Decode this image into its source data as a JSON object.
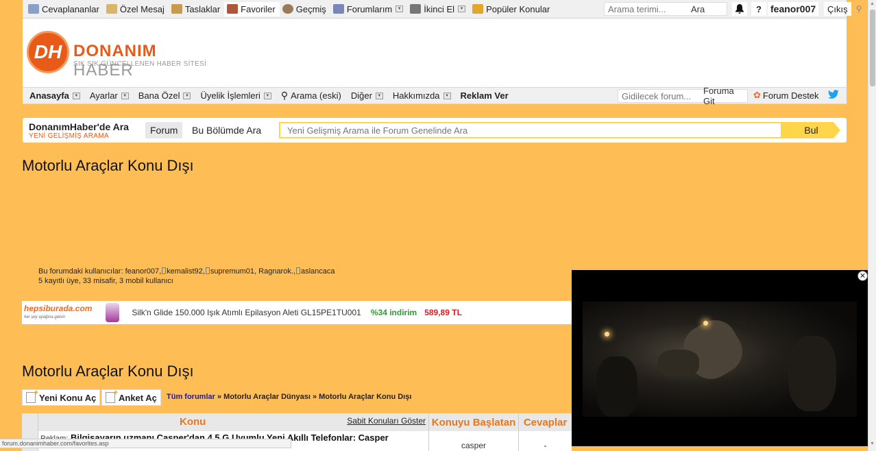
{
  "topbar": {
    "items": [
      {
        "label": "Cevaplananlar",
        "icon": "replies-icon",
        "color": "#8aa0c8"
      },
      {
        "label": "Özel Mesaj",
        "icon": "envelope-icon",
        "color": "#d9b56a"
      },
      {
        "label": "Taslaklar",
        "icon": "drafts-icon",
        "color": "#c79a4c"
      },
      {
        "label": "Favoriler",
        "icon": "heart-icon",
        "color": "#b0553a"
      },
      {
        "label": "Geçmiş",
        "icon": "history-icon",
        "color": "#9a7a5a"
      },
      {
        "label": "Forumlarım",
        "icon": "forums-icon",
        "color": "#7a86b8"
      },
      {
        "label": "İkinci El",
        "icon": "cart-icon",
        "color": "#777777"
      },
      {
        "label": "Popüler Konular",
        "icon": "popular-icon",
        "color": "#e2a62a"
      }
    ],
    "search_placeholder": "Arama terimi...",
    "search_button": "Ara",
    "help": "?",
    "username": "feanor007",
    "logout": "Çıkış"
  },
  "header": {
    "logo_letters": "DH",
    "logo_word_a": "DONANIM",
    "logo_word_b": "HABER",
    "tagline": "SIK SIK GÜNCELLENEN HABER SİTESİ"
  },
  "nav": {
    "items": [
      "Anasayfa",
      "Ayarlar",
      "Bana Özel",
      "Üyelik İşlemleri",
      "Arama (eski)",
      "Diğer",
      "Hakkımızda",
      "Reklam Ver"
    ],
    "goto_placeholder": "Gidilecek forum...",
    "goto_button": "Foruma Git",
    "support": "Forum Destek"
  },
  "searchbar": {
    "title": "DonanımHaber'de Ara",
    "subtitle": "YENİ GELİŞMİŞ ARAMA",
    "tab_forum": "Forum",
    "tab_section": "Bu Bölümde Ara",
    "placeholder": "Yeni Gelişmiş Arama ile Forum Genelinde Ara",
    "button": "Bul"
  },
  "page": {
    "title": "Motorlu Araçlar Konu Dışı",
    "title2": "Motorlu Araçlar Konu Dışı"
  },
  "users": {
    "label": "Bu forumdaki kullanıcılar:",
    "list": [
      "feanor007",
      "kemalist92",
      "supremum01",
      "Ragnarok.",
      "aslancaca"
    ],
    "summary": "5 kayıtlı üye, 33 misafir, 3 mobil kullanıcı"
  },
  "ad": {
    "brand": "hepsiburada.com",
    "brand_sub": "her şey ayağına gelsin",
    "product": "Silk'n Glide 150.000 Işık Atımlı Epilasyon Aleti GL15PE1TU001",
    "discount": "%34 indirim",
    "price": "589,89 TL"
  },
  "actions": {
    "new_topic": "Yeni Konu Aç",
    "new_poll": "Anket Aç"
  },
  "breadcrumb": {
    "all": "Tüm forumlar",
    "sep": "»",
    "level1": "Motorlu Araçlar Dünyası",
    "level2": "Motorlu Araçlar Konu Dışı"
  },
  "table": {
    "col_topic": "Konu",
    "show_sticky": "Sabit Konuları Göster",
    "col_starter": "Konuyu Başlatan",
    "col_replies": "Cevaplar",
    "rows": [
      {
        "prefix": "Reklam:",
        "title": "Bilgisayarın uzmanı Casper'dan 4.5 G Uyumlu Yeni Akıllı Telefonlar: Casper",
        "starter": "casper",
        "replies": "-"
      }
    ]
  },
  "status_url": "forum.donanimhaber.com/favorites.asp"
}
